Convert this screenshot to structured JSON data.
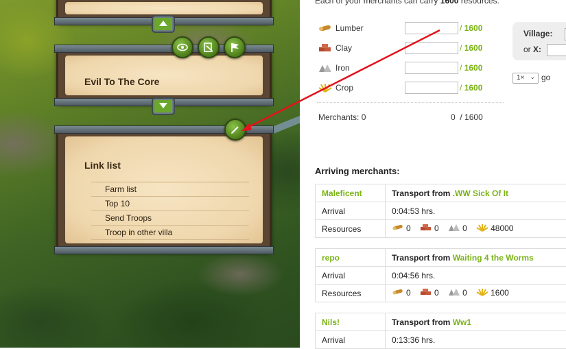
{
  "left_panels": {
    "panel2_title": "Evil To The Core",
    "panel3_title": "Link list",
    "links": [
      "Farm list",
      "Top 10",
      "Send Troops",
      "Troop in other villa"
    ]
  },
  "marketplace": {
    "intro_prefix": "Each of your merchants can carry",
    "intro_amount": "1600",
    "intro_suffix": "resources.",
    "resources": [
      {
        "name": "Lumber",
        "icon": "lumber-icon",
        "value": "",
        "max": "1600"
      },
      {
        "name": "Clay",
        "icon": "clay-icon",
        "value": "",
        "max": "1600"
      },
      {
        "name": "Iron",
        "icon": "iron-icon",
        "value": "",
        "max": "1600"
      },
      {
        "name": "Crop",
        "icon": "crop-icon",
        "value": "",
        "max": "1600"
      }
    ],
    "slash": "/",
    "merchants_label": "Merchants: 0",
    "merchants_load": "0",
    "merchants_capacity": "1600",
    "village_label": "Village:",
    "or_label": "or",
    "x_label": "X:",
    "multiplier": "1×",
    "go_label": "go"
  },
  "arriving": {
    "title": "Arriving merchants:",
    "arrival_label": "Arrival",
    "resources_label": "Resources",
    "transport_from_label": "Transport from",
    "transports": [
      {
        "player": "Maleficent",
        "village": ".WW Sick Of It",
        "arrival": "0:04:53 hrs.",
        "lumber": "0",
        "clay": "0",
        "iron": "0",
        "crop": "48000"
      },
      {
        "player": "repo",
        "village": "Waiting 4 the Worms",
        "arrival": "0:04:56 hrs.",
        "lumber": "0",
        "clay": "0",
        "iron": "0",
        "crop": "1600"
      },
      {
        "player": "Nils!",
        "village": "Ww1",
        "arrival": "0:13:36 hrs."
      }
    ]
  },
  "colors": {
    "accent_green": "#7ab317",
    "annotation_arrow": "#e3141b"
  }
}
